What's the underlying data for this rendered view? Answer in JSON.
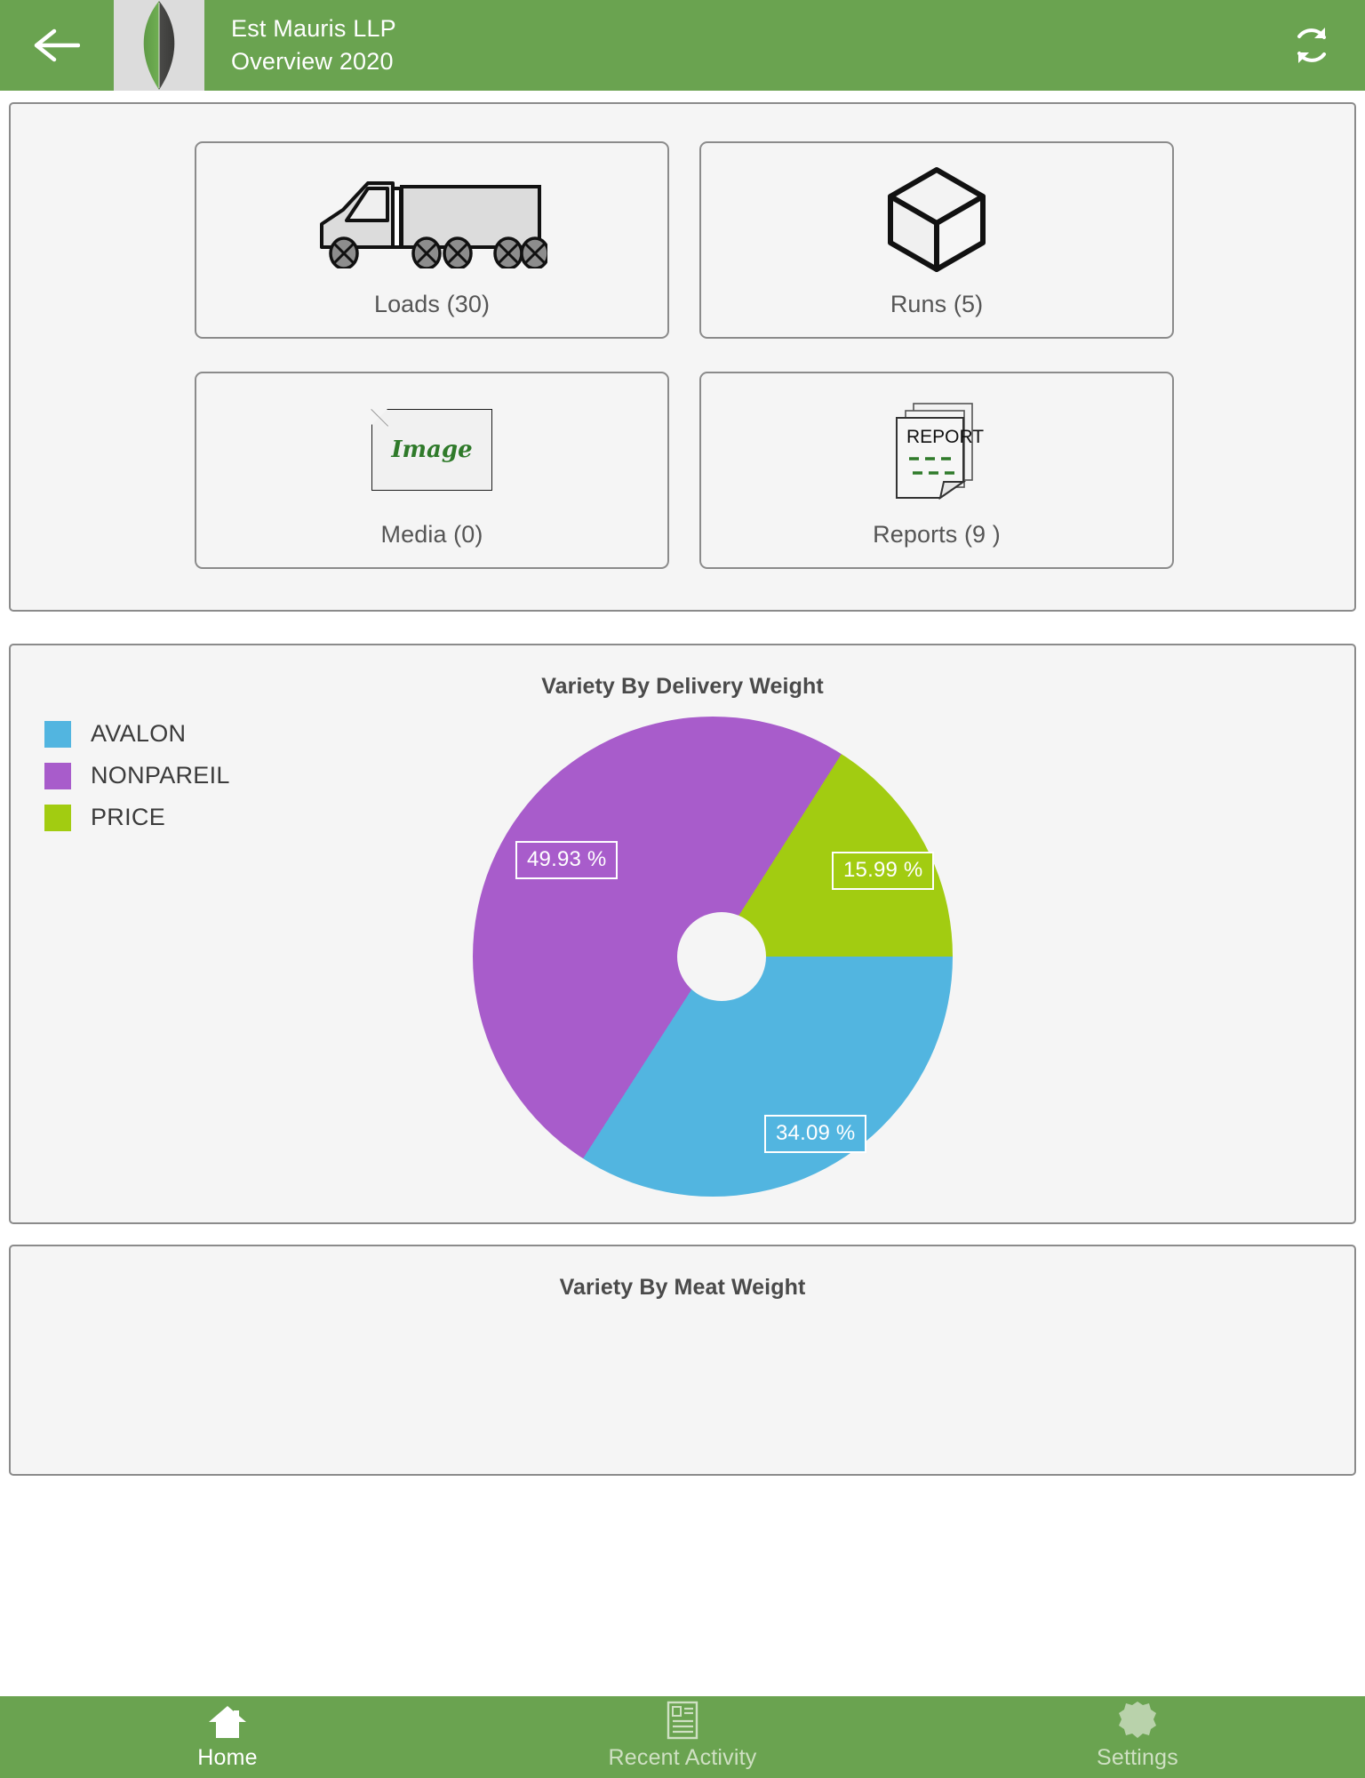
{
  "header": {
    "back_icon": "arrow-left-icon",
    "thumbnail_icon": "leaf-image",
    "title": "Est Mauris LLP",
    "subtitle": "Overview 2020",
    "refresh_icon": "refresh-icon",
    "background_color": "#6aa350"
  },
  "tiles": [
    {
      "icon": "truck-icon",
      "label": "Loads (30)"
    },
    {
      "icon": "cube-icon",
      "label": "Runs (5)"
    },
    {
      "icon": "image-placeholder-icon",
      "label": "Media (0)",
      "placeholder_text": "Image"
    },
    {
      "icon": "report-document-icon",
      "label": "Reports (9 )",
      "icon_text": "REPORT"
    }
  ],
  "chart_data": [
    {
      "type": "pie",
      "title": "Variety By Delivery Weight",
      "categories": [
        "AVALON",
        "NONPAREIL",
        "PRICE"
      ],
      "values": [
        34.09,
        49.93,
        15.99
      ],
      "labels": [
        "34.09 %",
        "49.93 %",
        "15.99 %"
      ],
      "colors": [
        "#52b5e0",
        "#a85ccb",
        "#a2cc11"
      ],
      "legend_position": "left",
      "donut_hole": true,
      "xlabel": "",
      "ylabel": ""
    },
    {
      "type": "pie",
      "title": "Variety By Meat Weight",
      "categories": [],
      "values": [],
      "labels": [],
      "colors": [],
      "legend_position": "left",
      "xlabel": "",
      "ylabel": ""
    }
  ],
  "bottom_nav": [
    {
      "icon": "home-icon",
      "label": "Home",
      "active": true
    },
    {
      "icon": "recent-activity-icon",
      "label": "Recent Activity",
      "active": false
    },
    {
      "icon": "settings-gear-icon",
      "label": "Settings",
      "active": false
    }
  ]
}
